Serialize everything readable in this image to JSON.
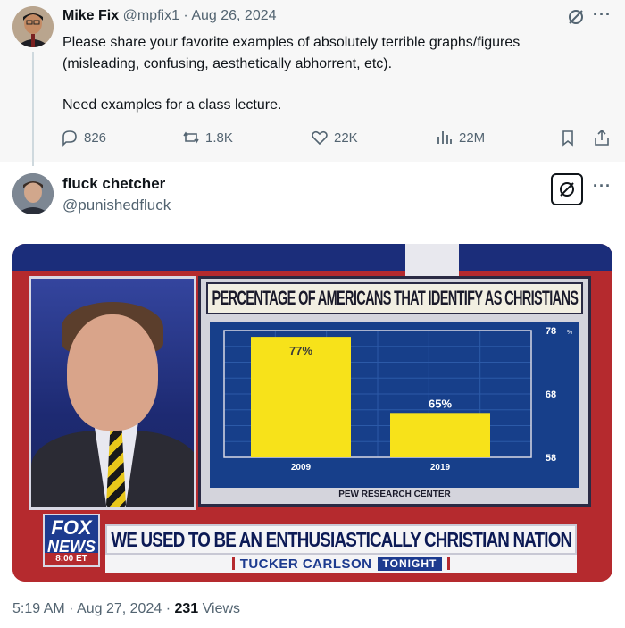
{
  "parent_tweet": {
    "author_name": "Mike Fix",
    "handle": "@mpfix1",
    "separator": "·",
    "date": "Aug 26, 2024",
    "text_line1": "Please share your favorite examples of absolutely terrible graphs/figures",
    "text_line2": "(misleading, confusing, aesthetically abhorrent, etc).",
    "text_line3": "Need examples for a class lecture.",
    "replies": "826",
    "reposts": "1.8K",
    "likes": "22K",
    "views": "22M",
    "icons": [
      "grok-icon",
      "more-icon",
      "reply-icon",
      "repost-icon",
      "like-icon",
      "views-icon",
      "bookmark-icon",
      "share-icon"
    ]
  },
  "main_tweet": {
    "author_name": "fluck chetcher",
    "handle": "@punishedfluck",
    "time": "5:19 AM",
    "separator": "·",
    "date": "Aug 27, 2024",
    "views_count": "231",
    "views_label": "Views",
    "icons": [
      "grok-icon",
      "more-icon"
    ]
  },
  "tv_graphic": {
    "chart_title": "PERCENTAGE OF AMERICANS THAT IDENTIFY AS CHRISTIANS",
    "source": "PEW RESEARCH CENTER",
    "logo_top": "FOX",
    "logo_bottom": "NEWS",
    "logo_time": "8:00 ET",
    "headline": "WE USED TO BE AN ENTHUSIASTICALLY CHRISTIAN NATION",
    "show_host": "TUCKER CARLSON",
    "show_name": "TONIGHT",
    "colors": {
      "bar": "#f7e21a",
      "chart_bg": "#173f8a",
      "brand_red": "#b52a2e",
      "brand_blue": "#1d3b8f"
    }
  },
  "chart_data": {
    "type": "bar",
    "title": "PERCENTAGE OF AMERICANS THAT IDENTIFY AS CHRISTIANS",
    "categories": [
      "2009",
      "2019"
    ],
    "values": [
      77,
      65
    ],
    "value_labels": [
      "77%",
      "65%"
    ],
    "ylim": [
      58,
      78
    ],
    "yticks": [
      "58",
      "68",
      "78"
    ],
    "ytick_values": [
      58,
      68,
      78
    ],
    "ylabel_unit": "%",
    "grid": true,
    "legend": "none"
  }
}
